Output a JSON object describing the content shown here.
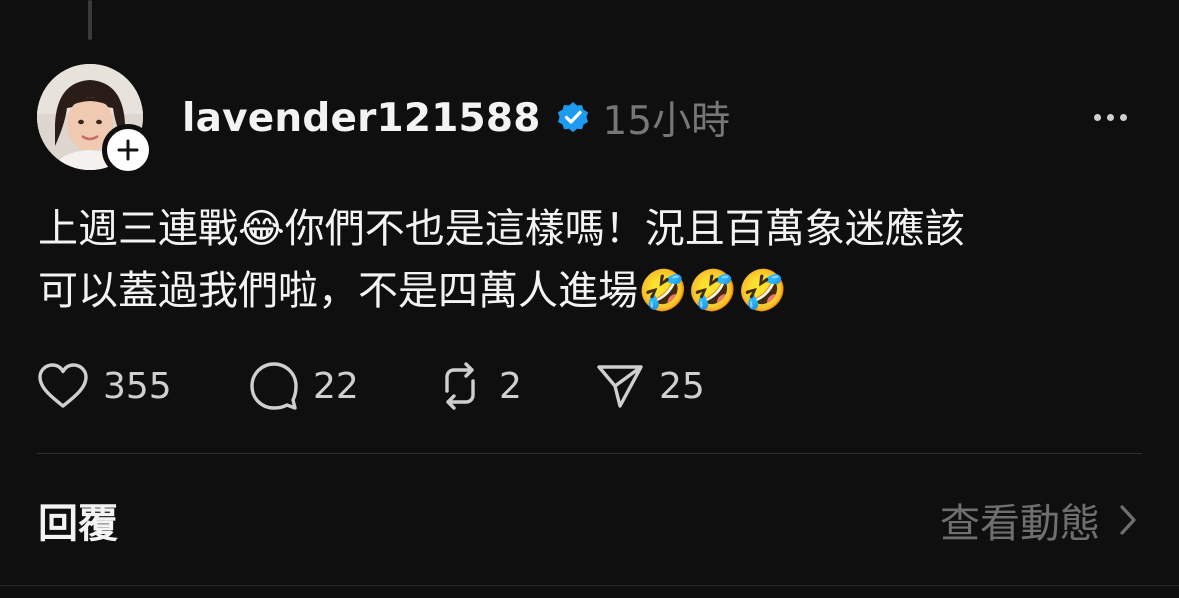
{
  "post": {
    "username": "lavender121588",
    "verified": true,
    "time": "15小時",
    "text_lines": [
      "上週三連戰😂你們不也是這樣嗎！況且百萬象迷應該",
      "可以蓋過我們啦，不是四萬人進場🤣🤣🤣"
    ]
  },
  "actions": {
    "likes": "355",
    "replies": "22",
    "reposts": "2",
    "shares": "25"
  },
  "footer": {
    "replies_label": "回覆",
    "view_activity_label": "查看動態"
  },
  "colors": {
    "background": "#0f0f0f",
    "text": "#f3f3f3",
    "muted": "#777777",
    "verified_blue": "#1d9bf0"
  },
  "icons": {
    "more": "more-horizontal-icon",
    "like": "heart-icon",
    "reply": "comment-bubble-icon",
    "repost": "repost-icon",
    "share": "send-icon",
    "chevron": "chevron-right-icon",
    "follow": "plus-icon",
    "verified": "verified-badge-icon"
  }
}
